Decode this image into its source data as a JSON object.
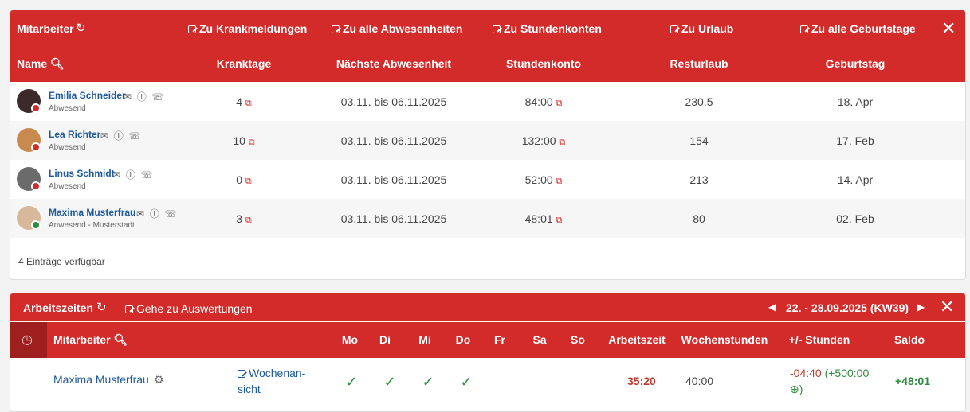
{
  "employees_panel": {
    "title": "Mitarbeiter",
    "links": [
      "Zu Krankmeldungen",
      "Zu alle Abwesenheiten",
      "Zu Stundenkonten",
      "Zu Urlaub",
      "Zu alle Geburtstage"
    ],
    "columns": {
      "name": "Name",
      "sick": "Kranktage",
      "next_absence": "Nächste Abwesenheit",
      "hours": "Stundenkonto",
      "vacation": "Resturlaub",
      "birthday": "Geburtstag"
    },
    "rows": [
      {
        "name": "Emilia Schneider",
        "status": "Abwesend",
        "sick": "4",
        "next": "03.11. bis 06.11.2025",
        "hours": "84:00",
        "vacation": "230.5",
        "birthday": "18. Apr"
      },
      {
        "name": "Lea Richter",
        "status": "Abwesend",
        "sick": "10",
        "next": "03.11. bis 06.11.2025",
        "hours": "132:00",
        "vacation": "154",
        "birthday": "17. Feb"
      },
      {
        "name": "Linus Schmidt",
        "status": "Abwesend",
        "sick": "0",
        "next": "03.11. bis 06.11.2025",
        "hours": "52:00",
        "vacation": "213",
        "birthday": "14. Apr"
      },
      {
        "name": "Maxima Musterfrau",
        "status": "Anwesend - Musterstadt",
        "sick": "3",
        "next": "03.11. bis 06.11.2025",
        "hours": "48:01",
        "vacation": "80",
        "birthday": "02. Feb"
      }
    ],
    "footer": "4 Einträge verfügbar"
  },
  "worktime_panel": {
    "title": "Arbeitszeiten",
    "link": "Gehe zu Auswertungen",
    "week": "22. - 28.09.2025 (KW39)",
    "columns": {
      "employee": "Mitarbeiter",
      "mo": "Mo",
      "di": "Di",
      "mi": "Mi",
      "do": "Do",
      "fr": "Fr",
      "sa": "Sa",
      "so": "So",
      "worktime": "Arbeitszeit",
      "weekly": "Wochenstunden",
      "diff": "+/- Stunden",
      "saldo": "Saldo"
    },
    "row": {
      "name": "Maxima Musterfrau",
      "week_view_1": "Wochenan-",
      "week_view_2": "sicht",
      "worktime": "35:20",
      "weekly": "40:00",
      "diff_neg": "-04:40",
      "diff_pos": "(+500:00",
      "diff_end": ")",
      "saldo": "+48:01"
    }
  },
  "colors": {
    "brand_red": "#d32a2a",
    "link_blue": "#1d5a9c",
    "green": "#2e8b3f"
  }
}
